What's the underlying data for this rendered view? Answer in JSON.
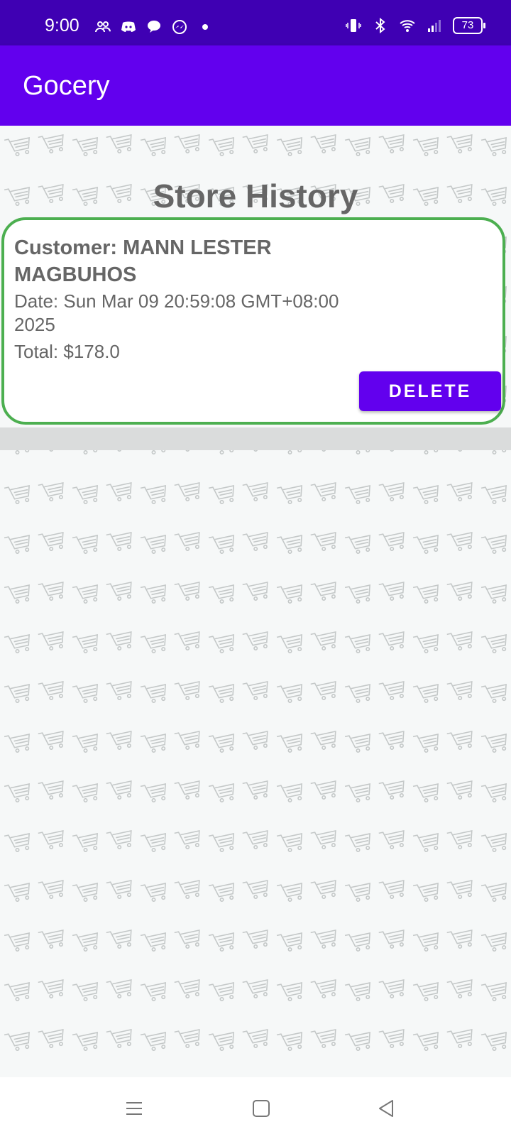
{
  "status_bar": {
    "time": "9:00",
    "battery": "73",
    "left_icons": [
      "people-icon",
      "discord-icon",
      "chat-bubble-icon",
      "messenger-icon"
    ],
    "right_icons": [
      "vibrate-icon",
      "bluetooth-icon",
      "wifi-icon",
      "signal-icon"
    ]
  },
  "app_bar": {
    "title": "Gocery"
  },
  "page": {
    "title": "Store History",
    "background_icon": "shopping-cart-icon",
    "accent": "#6200ee",
    "card_border": "#4caf50"
  },
  "history": [
    {
      "customer": "Customer: MANN LESTER MAGBUHOS",
      "date": "Date: Sun Mar 09 20:59:08 GMT+08:00 2025",
      "total": "Total: $178.0",
      "delete_label": "DELETE"
    }
  ],
  "nav": {
    "icons": [
      "menu-icon",
      "home-square-icon",
      "back-triangle-icon"
    ]
  }
}
